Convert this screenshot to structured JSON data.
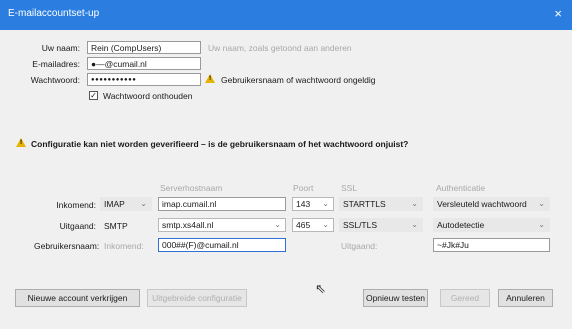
{
  "window": {
    "title": "E-mailaccountset-up",
    "close_glyph": "×"
  },
  "account": {
    "name_label": "Uw naam:",
    "name_value": "Rein (CompUsers)",
    "name_hint": "Uw naam, zoals getoond aan anderen",
    "email_label": "E-mailadres:",
    "email_value": "●—@cumail.nl",
    "password_label": "Wachtwoord:",
    "password_value": "●●●●●●●●●●●",
    "password_warning": "Gebruikersnaam of wachtwoord ongeldig",
    "remember_label": "Wachtwoord onthouden",
    "remember_checked": true
  },
  "config_warning": "Configuratie kan niet worden geverifieerd – is de gebruikersnaam of het wachtwoord onjuist?",
  "server_table": {
    "headers": [
      "Serverhostnaam",
      "Poort",
      "SSL",
      "Authenticatie"
    ],
    "incoming": {
      "label": "Inkomend:",
      "protocol": "IMAP",
      "host": "imap.cumail.nl",
      "port": "143",
      "ssl": "STARTTLS",
      "auth": "Versleuteld wachtwoord"
    },
    "outgoing": {
      "label": "Uitgaand:",
      "protocol": "SMTP",
      "host": "smtp.xs4all.nl",
      "port": "465",
      "ssl": "SSL/TLS",
      "auth": "Autodetectie"
    },
    "username": {
      "label": "Gebruikersnaam:",
      "incoming_label": "Inkomend:",
      "incoming_value": "000##(F)@cumail.nl",
      "outgoing_label": "Uitgaand:",
      "outgoing_value": "~#Jk#Ju"
    }
  },
  "buttons": {
    "new_account": "Nieuwe account verkrijgen",
    "advanced": "Uitgebreide configuratie",
    "retest": "Opnieuw testen",
    "done": "Gereed",
    "cancel": "Annuleren"
  },
  "icons": {
    "warning": "warning-icon",
    "chevron": "chevron-down-icon",
    "close": "close-icon",
    "checkbox": "checkbox-icon"
  }
}
